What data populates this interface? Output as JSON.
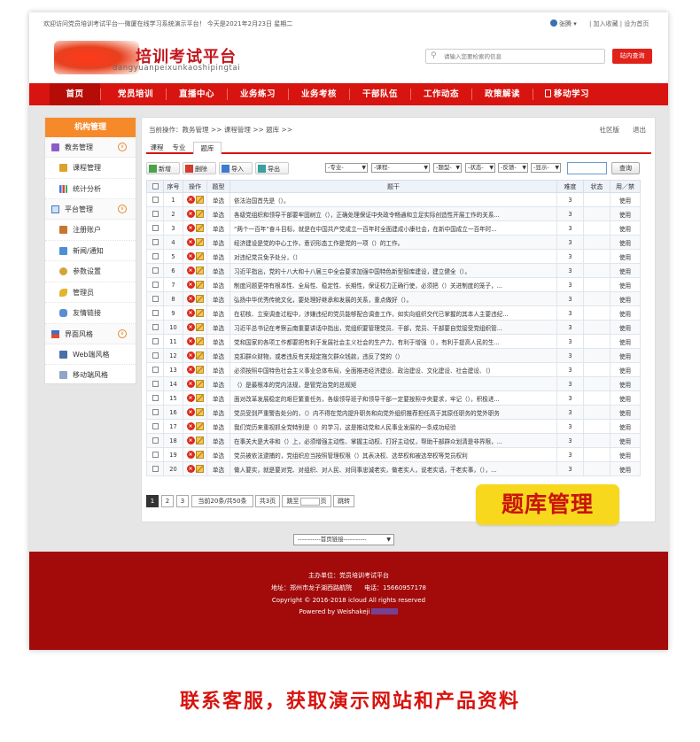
{
  "topbar": {
    "welcome": "欢迎访问党员培训考试平台---微厦在线学习系统演示平台！ 今天是2021年2月23日 星期二",
    "user_name": "张腾 ▾",
    "links": "| 加入收藏 | 设为首页"
  },
  "logo": {
    "title": "培训考试平台",
    "pinyin": "peixunkaoshipingtai",
    "pinyin_prefix": "dangyuan"
  },
  "search": {
    "placeholder": "请输入您要检索的信息",
    "button": "站内查询"
  },
  "nav": [
    "首页",
    "党员培训",
    "直播中心",
    "业务练习",
    "业务考核",
    "干部队伍",
    "工作动态",
    "政策解读",
    "移动学习"
  ],
  "sidebar": {
    "title": "机构管理",
    "groups": [
      {
        "label": "教务管理",
        "items": [
          "课程管理",
          "统计分析"
        ]
      },
      {
        "label": "平台管理",
        "items": [
          "注册账户",
          "新闻/通知",
          "参数设置",
          "管理员",
          "友情链接"
        ]
      },
      {
        "label": "界面风格",
        "items": [
          "Web端风格",
          "移动端风格"
        ]
      }
    ]
  },
  "crumb": {
    "text": "当前操作：教务管理 >> 课程管理 >> 题库 >>",
    "right": [
      "社区版",
      "退出"
    ]
  },
  "tabs": [
    "课程",
    "专业",
    "题库"
  ],
  "toolbar": {
    "buttons": [
      "新增",
      "删除",
      "导入",
      "导出"
    ],
    "filters": [
      "-专业-",
      "-课程-",
      "-题型-",
      "-状态-",
      "-反馈-",
      "-显示-"
    ],
    "query": "查询"
  },
  "table": {
    "headers": [
      "",
      "序号",
      "操作",
      "题型",
      "题干",
      "难度",
      "状态",
      "用／禁"
    ],
    "rows": [
      {
        "no": "1",
        "type": "单选",
        "stem": "依法治国首先是（）。",
        "level": "3",
        "status": "",
        "use": "使用"
      },
      {
        "no": "2",
        "type": "单选",
        "stem": "各级党组织和领导干部要牢固树立（），正确处理保证中央政令畅通和立足实际创造性开展工作的关系...",
        "level": "3",
        "status": "",
        "use": "使用"
      },
      {
        "no": "3",
        "type": "单选",
        "stem": "“两个一百年”奋斗目标，就是在中国共产党成立一百年时全面建成小康社会，在新中国成立一百年时...",
        "level": "3",
        "status": "",
        "use": "使用"
      },
      {
        "no": "4",
        "type": "单选",
        "stem": "经济建设是党的中心工作，意识形态工作是党的一项（）的工作。",
        "level": "3",
        "status": "",
        "use": "使用"
      },
      {
        "no": "5",
        "type": "单选",
        "stem": "对违纪党员免予处分，（）",
        "level": "3",
        "status": "",
        "use": "使用"
      },
      {
        "no": "6",
        "type": "单选",
        "stem": "习近平指出，党的十八大和十八届三中全会要求加强中国特色新型智库建设，建立健全（）。",
        "level": "3",
        "status": "",
        "use": "使用"
      },
      {
        "no": "7",
        "type": "单选",
        "stem": "制度问题更带有根本性、全局性、稳定性、长期性，保证权力正确行使，必须把（）关进制度的笼子，...",
        "level": "3",
        "status": "",
        "use": "使用"
      },
      {
        "no": "8",
        "type": "单选",
        "stem": "弘扬中华优秀传统文化，要处理好继承和发展的关系，重点做好（）。",
        "level": "3",
        "status": "",
        "use": "使用"
      },
      {
        "no": "9",
        "type": "单选",
        "stem": "在初核、立案调查过程中，涉嫌违纪的党员能够配合调查工作，如实向组织交代已掌握的其本人主要违纪...",
        "level": "3",
        "status": "",
        "use": "使用"
      },
      {
        "no": "10",
        "type": "单选",
        "stem": "习近平总书记在考察云南重要讲话中指出，党组织要管理党员、干部，党员、干部要自觉接受党组织管...",
        "level": "3",
        "status": "",
        "use": "使用"
      },
      {
        "no": "11",
        "type": "单选",
        "stem": "党和国家的各项工作都要把有利于发展社会主义社会的生产力，有利于增强（），有利于提高人民的生...",
        "level": "3",
        "status": "",
        "use": "使用"
      },
      {
        "no": "12",
        "type": "单选",
        "stem": "克扣群众财物，或者违反有关规定拖欠群众钱款，违反了党的（）",
        "level": "3",
        "status": "",
        "use": "使用"
      },
      {
        "no": "13",
        "type": "单选",
        "stem": "必须按照中国特色社会主义事业总体布局，全面推进经济建设、政治建设、文化建设、社会建设、（）",
        "level": "3",
        "status": "",
        "use": "使用"
      },
      {
        "no": "14",
        "type": "单选",
        "stem": "（）是最根本的党内法规，是管党治党的总规矩",
        "level": "3",
        "status": "",
        "use": "使用"
      },
      {
        "no": "15",
        "type": "单选",
        "stem": "面对改革发展稳定的艰巨繁重任务，各级领导班子和领导干部一定要按照中央要求，牢记（），积极进...",
        "level": "3",
        "status": "",
        "use": "使用"
      },
      {
        "no": "16",
        "type": "单选",
        "stem": "党员受到严重警告处分的，（）内不得在党内提升职务和向党外组织推荐担任高于其原任职务的党外职务",
        "level": "3",
        "status": "",
        "use": "使用"
      },
      {
        "no": "17",
        "type": "单选",
        "stem": "我们党历来重视抓全党特别是（）的学习，这是推动党和人民事业发展的一条成功经验",
        "level": "3",
        "status": "",
        "use": "使用"
      },
      {
        "no": "18",
        "type": "单选",
        "stem": "在事关大是大非和（）上，必须增强主动性、掌握主动权、打好主动仗，帮助干部群众划清是非界限，...",
        "level": "3",
        "status": "",
        "use": "使用"
      },
      {
        "no": "19",
        "type": "单选",
        "stem": "党员被依法逮捕的，党组织应当按照管理权限（）其表决权、选举权和被选举权等党员权利",
        "level": "3",
        "status": "",
        "use": "使用"
      },
      {
        "no": "20",
        "type": "单选",
        "stem": "做人要实，就是要对党、对组织、对人民、对同事忠诚老实，做老实人，说老实话，干老实事，（），...",
        "level": "3",
        "status": "",
        "use": "使用"
      }
    ]
  },
  "pager": {
    "pages": [
      "1",
      "2",
      "3"
    ],
    "summary": "当前20条/共50条",
    "total_pages": "共3页",
    "jump_label": "跳至",
    "page_unit": "页",
    "go": "跳转"
  },
  "stamp": "题库管理",
  "quicklinks": "-----------首页链接-----------",
  "footer": {
    "owner": "主办单位：党员培训考试平台",
    "address": "地址：郑州市龙子湖西路航院　　电话：15660957178",
    "copyright": "Copyright © 2016-2018 icloud All rights reserved",
    "powered": "Powered by Weishakeji"
  },
  "cta": "联系客服，获取演示网站和产品资料",
  "colors": {
    "brand_red": "#d7140f",
    "footer_red": "#a30b0b",
    "orange": "#f68a2b",
    "stamp_yellow": "#f8d81c"
  }
}
